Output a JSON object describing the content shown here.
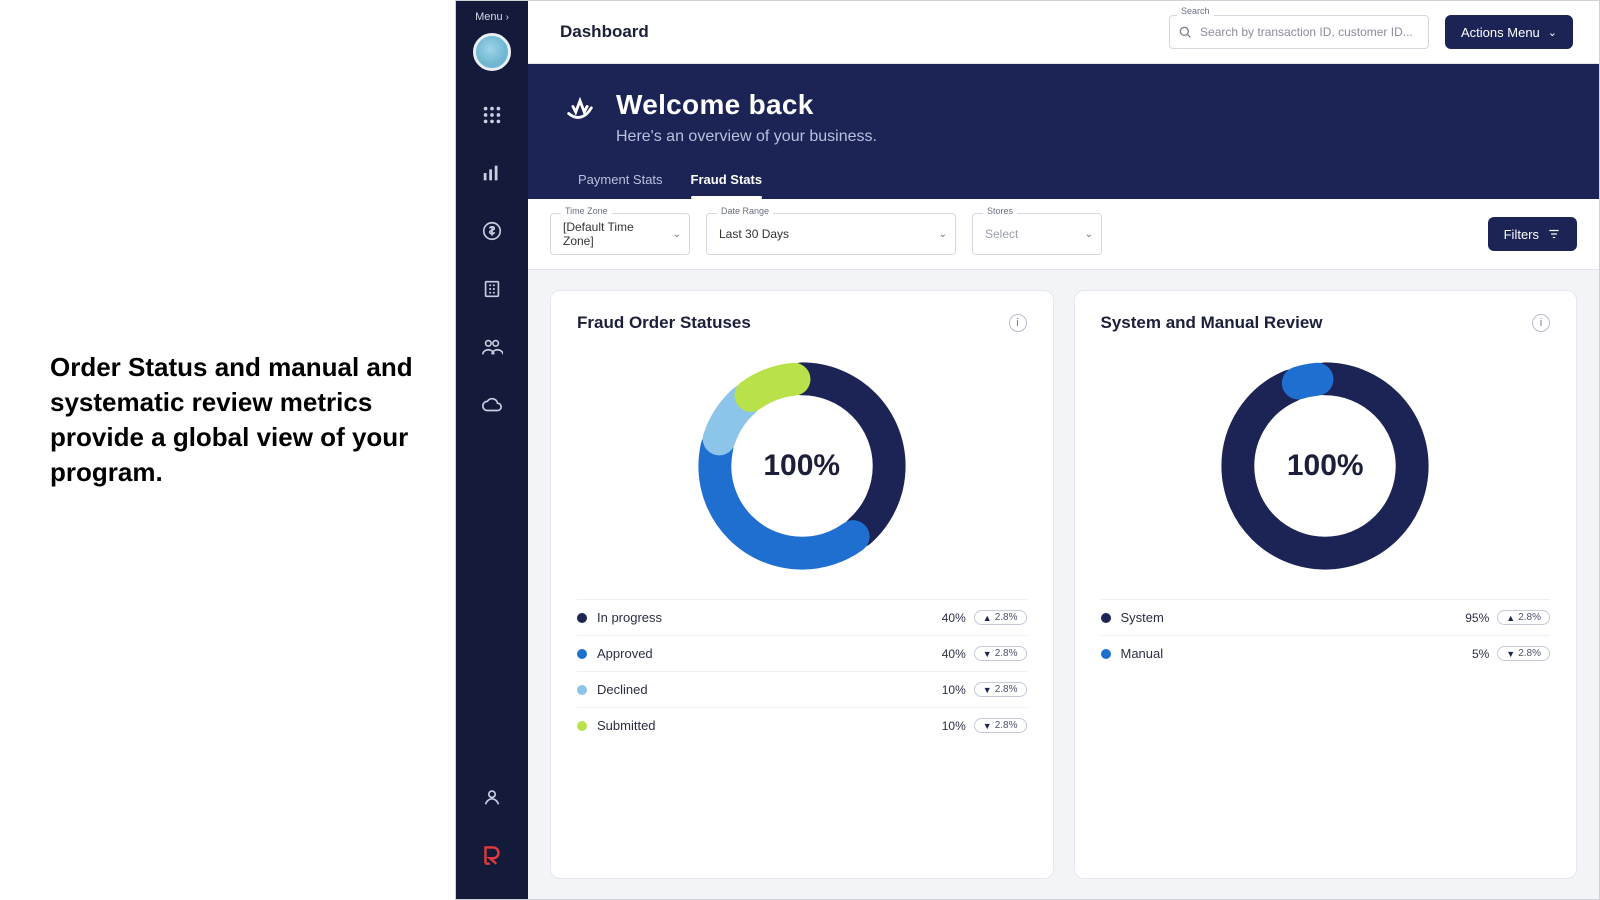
{
  "caption": "Order Status and manual and systematic review metrics provide a global view of your program.",
  "sidebar": {
    "menu_label": "Menu"
  },
  "header": {
    "title": "Dashboard",
    "search_label": "Search",
    "search_placeholder": "Search by transaction ID, customer ID...",
    "actions_label": "Actions Menu"
  },
  "hero": {
    "title": "Welcome back",
    "subtitle": "Here's an overview of your business.",
    "tabs": [
      {
        "label": "Payment Stats",
        "active": false
      },
      {
        "label": "Fraud Stats",
        "active": true
      }
    ]
  },
  "filters": {
    "time_zone": {
      "label": "Time Zone",
      "value": "[Default Time Zone]"
    },
    "date_range": {
      "label": "Date Range",
      "value": "Last 30 Days"
    },
    "stores": {
      "label": "Stores",
      "value": "Select"
    },
    "filters_button": "Filters"
  },
  "chart_data": [
    {
      "type": "pie",
      "title": "Fraud Order Statuses",
      "center_label": "100%",
      "series": [
        {
          "name": "In progress",
          "value": 40,
          "color": "#1b2455",
          "delta": "2.8%",
          "delta_dir": "up"
        },
        {
          "name": "Approved",
          "value": 40,
          "color": "#1f6fd1",
          "delta": "2.8%",
          "delta_dir": "down"
        },
        {
          "name": "Declined",
          "value": 10,
          "color": "#8cc4ea",
          "delta": "2.8%",
          "delta_dir": "down"
        },
        {
          "name": "Submitted",
          "value": 10,
          "color": "#b9e24a",
          "delta": "2.8%",
          "delta_dir": "down"
        }
      ]
    },
    {
      "type": "pie",
      "title": "System and Manual Review",
      "center_label": "100%",
      "series": [
        {
          "name": "System",
          "value": 95,
          "color": "#1b2455",
          "delta": "2.8%",
          "delta_dir": "up"
        },
        {
          "name": "Manual",
          "value": 5,
          "color": "#1f6fd1",
          "delta": "2.8%",
          "delta_dir": "down"
        }
      ]
    }
  ]
}
